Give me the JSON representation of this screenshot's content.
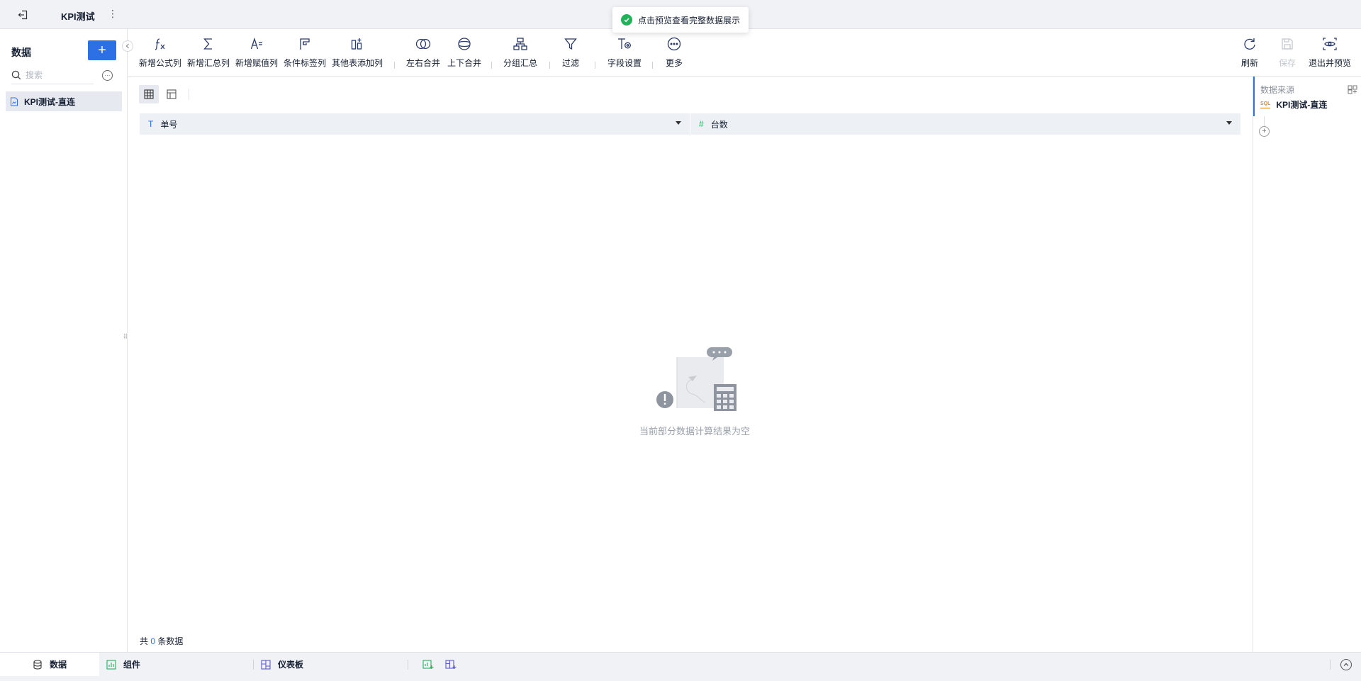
{
  "topbar": {
    "title": "KPI测试",
    "menu_glyph": "⋮"
  },
  "toast": {
    "message": "点击预览查看完整数据展示"
  },
  "sidebar": {
    "heading": "数据",
    "add_label": "+",
    "search_placeholder": "搜索",
    "items": [
      {
        "label": "KPI测试-直连",
        "selected": true
      }
    ]
  },
  "toolbar": {
    "tools": [
      {
        "label": "新增公式列",
        "icon": "formula-icon"
      },
      {
        "label": "新增汇总列",
        "icon": "sigma-icon"
      },
      {
        "label": "新增赋值列",
        "icon": "assign-icon"
      },
      {
        "label": "条件标签列",
        "icon": "flag-icon"
      },
      {
        "label": "其他表添加列",
        "icon": "add-column-icon"
      },
      {
        "label": "左右合并",
        "icon": "join-icon"
      },
      {
        "label": "上下合并",
        "icon": "union-icon"
      },
      {
        "label": "分组汇总",
        "icon": "group-icon"
      },
      {
        "label": "过滤",
        "icon": "filter-icon"
      },
      {
        "label": "字段设置",
        "icon": "field-settings-icon"
      },
      {
        "label": "更多",
        "icon": "more-icon"
      }
    ],
    "right_tools": [
      {
        "label": "刷新",
        "icon": "refresh-icon",
        "disabled": false
      },
      {
        "label": "保存",
        "icon": "save-icon",
        "disabled": true
      },
      {
        "label": "退出并预览",
        "icon": "preview-icon",
        "disabled": false
      }
    ]
  },
  "table": {
    "columns": [
      {
        "name": "单号",
        "type_glyph": "T",
        "type": "text"
      },
      {
        "name": "台数",
        "type_glyph": "#",
        "type": "number"
      }
    ],
    "empty_message": "当前部分数据计算结果为空",
    "count_prefix": "共",
    "count_value": "0",
    "count_suffix": "条数据"
  },
  "right_panel": {
    "heading": "数据来源",
    "source_badge": "SQL",
    "source_name": "KPI测试-直连"
  },
  "bottom_tabs": [
    {
      "label": "数据",
      "icon": "database-icon",
      "active": true
    },
    {
      "label": "组件",
      "icon": "chart-icon",
      "active": false
    },
    {
      "label": "仪表板",
      "icon": "dashboard-icon",
      "active": false
    }
  ],
  "colors": {
    "accent": "#2d6fe4",
    "success": "#22b35a",
    "icon": "#2a3a6b"
  }
}
